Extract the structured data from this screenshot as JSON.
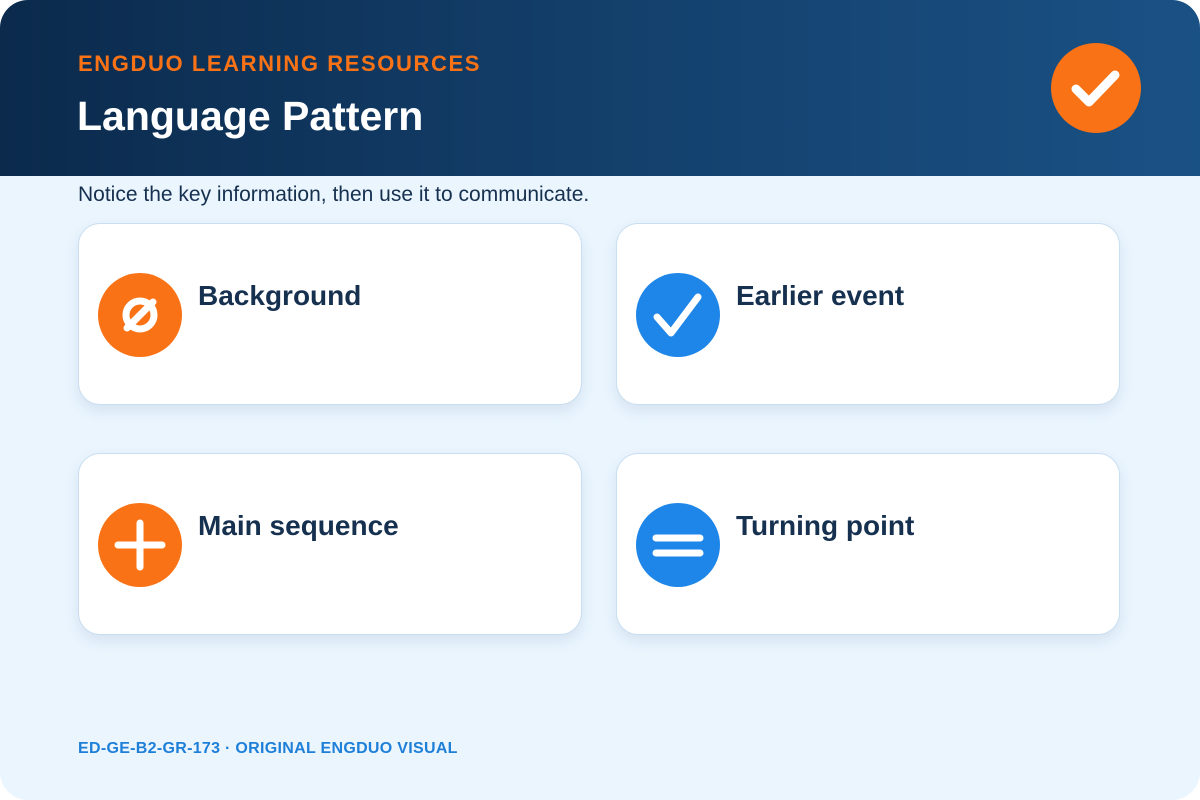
{
  "header": {
    "eyebrow": "ENGDUO LEARNING RESOURCES",
    "title": "Language Pattern",
    "badge_icon": "check-icon"
  },
  "subtitle": "Notice the key information, then use it to communicate.",
  "cards": [
    {
      "label": "Background",
      "icon": "empty-set-icon",
      "color": "#f97316"
    },
    {
      "label": "Earlier event",
      "icon": "check-icon",
      "color": "#1e86e8"
    },
    {
      "label": "Main sequence",
      "icon": "plus-icon",
      "color": "#f97316"
    },
    {
      "label": "Turning point",
      "icon": "equals-icon",
      "color": "#1e86e8"
    }
  ],
  "footer": "ED-GE-B2-GR-173 · ORIGINAL ENGDUO VISUAL",
  "colors": {
    "header_dark": "#0b2a4c",
    "accent_orange": "#f97316",
    "accent_blue": "#1e86e8",
    "page_background": "#eaf5fe",
    "text_dark": "#16304f"
  }
}
